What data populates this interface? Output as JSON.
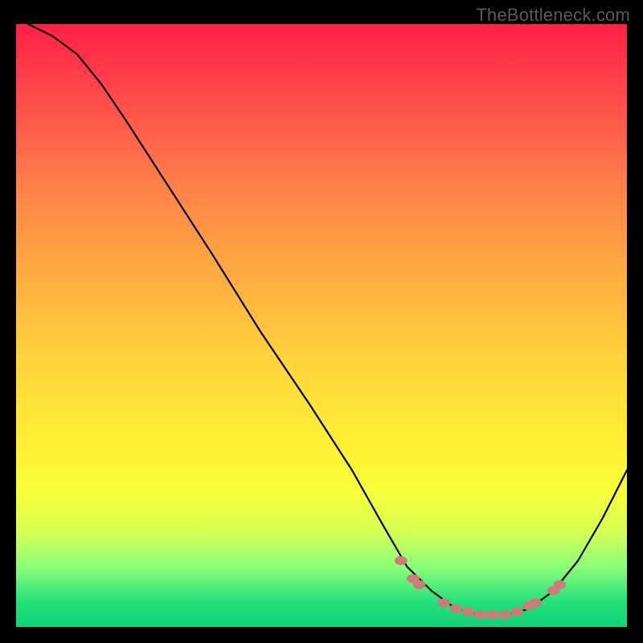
{
  "watermark": "TheBottleneck.com",
  "chart_data": {
    "type": "line",
    "title": "",
    "xlabel": "",
    "ylabel": "",
    "watermark": "TheBottleneck.com",
    "x_range": [
      0,
      100
    ],
    "y_range": [
      0,
      100
    ],
    "background_gradient": {
      "top": "#ff1f47",
      "mid": "#fff033",
      "bottom": "#0fd478"
    },
    "curve": {
      "description": "Bottleneck curve; y = bottleneck metric (0 best, 100 worst)",
      "points": [
        {
          "x": 2,
          "y": 100
        },
        {
          "x": 6,
          "y": 98
        },
        {
          "x": 10,
          "y": 95
        },
        {
          "x": 14,
          "y": 90
        },
        {
          "x": 18,
          "y": 84
        },
        {
          "x": 25,
          "y": 73
        },
        {
          "x": 32,
          "y": 62
        },
        {
          "x": 40,
          "y": 49
        },
        {
          "x": 48,
          "y": 37
        },
        {
          "x": 55,
          "y": 26
        },
        {
          "x": 60,
          "y": 17
        },
        {
          "x": 64,
          "y": 10
        },
        {
          "x": 68,
          "y": 6
        },
        {
          "x": 72,
          "y": 3
        },
        {
          "x": 76,
          "y": 2
        },
        {
          "x": 80,
          "y": 2
        },
        {
          "x": 84,
          "y": 3
        },
        {
          "x": 88,
          "y": 6
        },
        {
          "x": 92,
          "y": 11
        },
        {
          "x": 96,
          "y": 18
        },
        {
          "x": 100,
          "y": 26
        }
      ]
    },
    "highlight_points": {
      "description": "Hardware markers along the curve (salmon dots/lozenges)",
      "color": "#cd7c78",
      "points": [
        {
          "x": 63,
          "y": 11
        },
        {
          "x": 65,
          "y": 8
        },
        {
          "x": 66,
          "y": 7
        },
        {
          "x": 70,
          "y": 4
        },
        {
          "x": 72,
          "y": 3
        },
        {
          "x": 74,
          "y": 2.5
        },
        {
          "x": 76,
          "y": 2
        },
        {
          "x": 78,
          "y": 2
        },
        {
          "x": 80,
          "y": 2
        },
        {
          "x": 82,
          "y": 2.5
        },
        {
          "x": 84,
          "y": 3.5
        },
        {
          "x": 85,
          "y": 4
        },
        {
          "x": 88,
          "y": 6
        },
        {
          "x": 89,
          "y": 7
        }
      ]
    }
  }
}
